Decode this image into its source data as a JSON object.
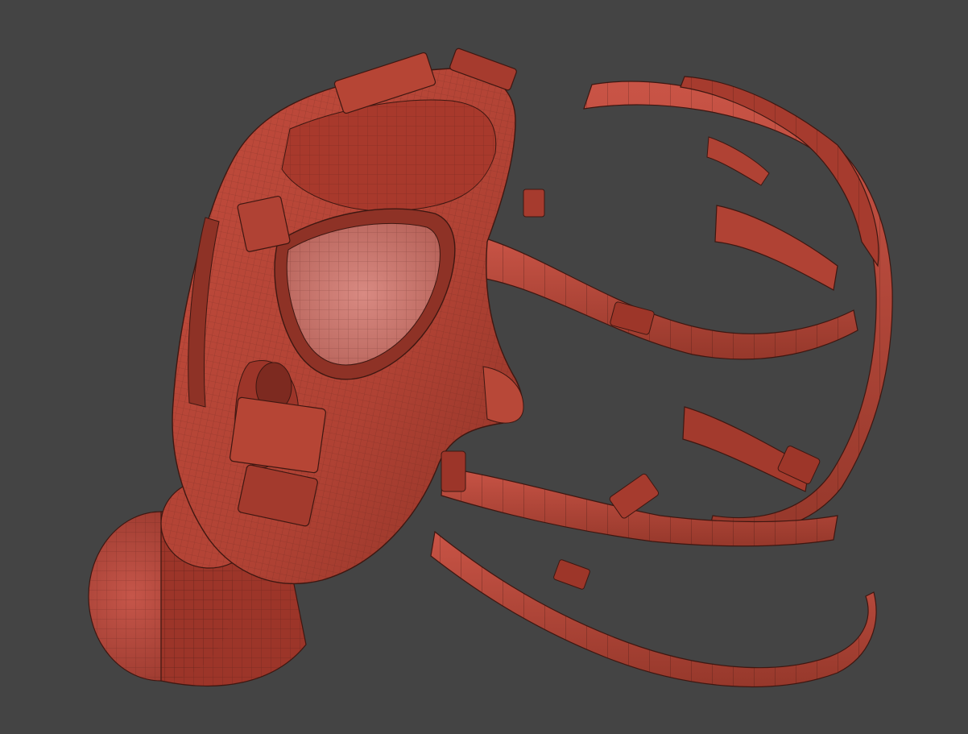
{
  "viewport": {
    "background_color": "#444444",
    "model": {
      "name": "gas-mask-wireframe",
      "base_color": "#b54335",
      "shade_color": "#8a2f24",
      "highlight_color": "#d6675a",
      "lens_color": "#c97a73",
      "wire_color": "#3a1a15",
      "parts": [
        "mask-body",
        "eye-lens",
        "filter-canister",
        "head-harness",
        "harness-straps",
        "buckles"
      ]
    }
  }
}
